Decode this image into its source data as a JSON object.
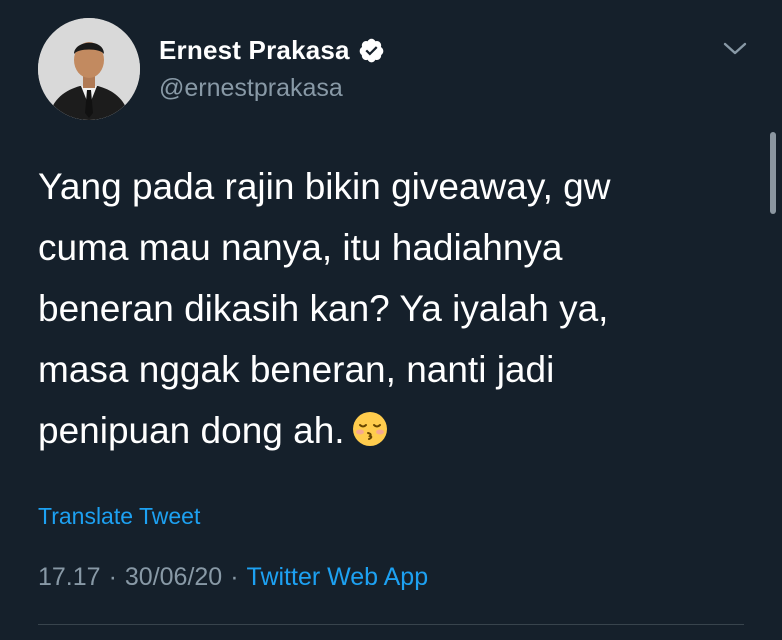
{
  "author": {
    "display_name": "Ernest Prakasa",
    "handle": "@ernestprakasa",
    "verified": true
  },
  "tweet": {
    "lines": [
      "Yang pada rajin bikin giveaway, gw",
      "cuma mau nanya, itu hadiahnya",
      "beneran dikasih kan? Ya iyalah ya,",
      "masa nggak beneran, nanti jadi",
      "penipuan dong ah."
    ],
    "emoji": "kissing-face-with-closed-eyes"
  },
  "translate_label": "Translate Tweet",
  "meta": {
    "time": "17.17",
    "separator": "·",
    "date": "30/06/20",
    "source": "Twitter Web App"
  },
  "colors": {
    "background": "#15202b",
    "link": "#1da1f2",
    "secondary_text": "#8899a6",
    "verified_badge": "#ffffff"
  }
}
